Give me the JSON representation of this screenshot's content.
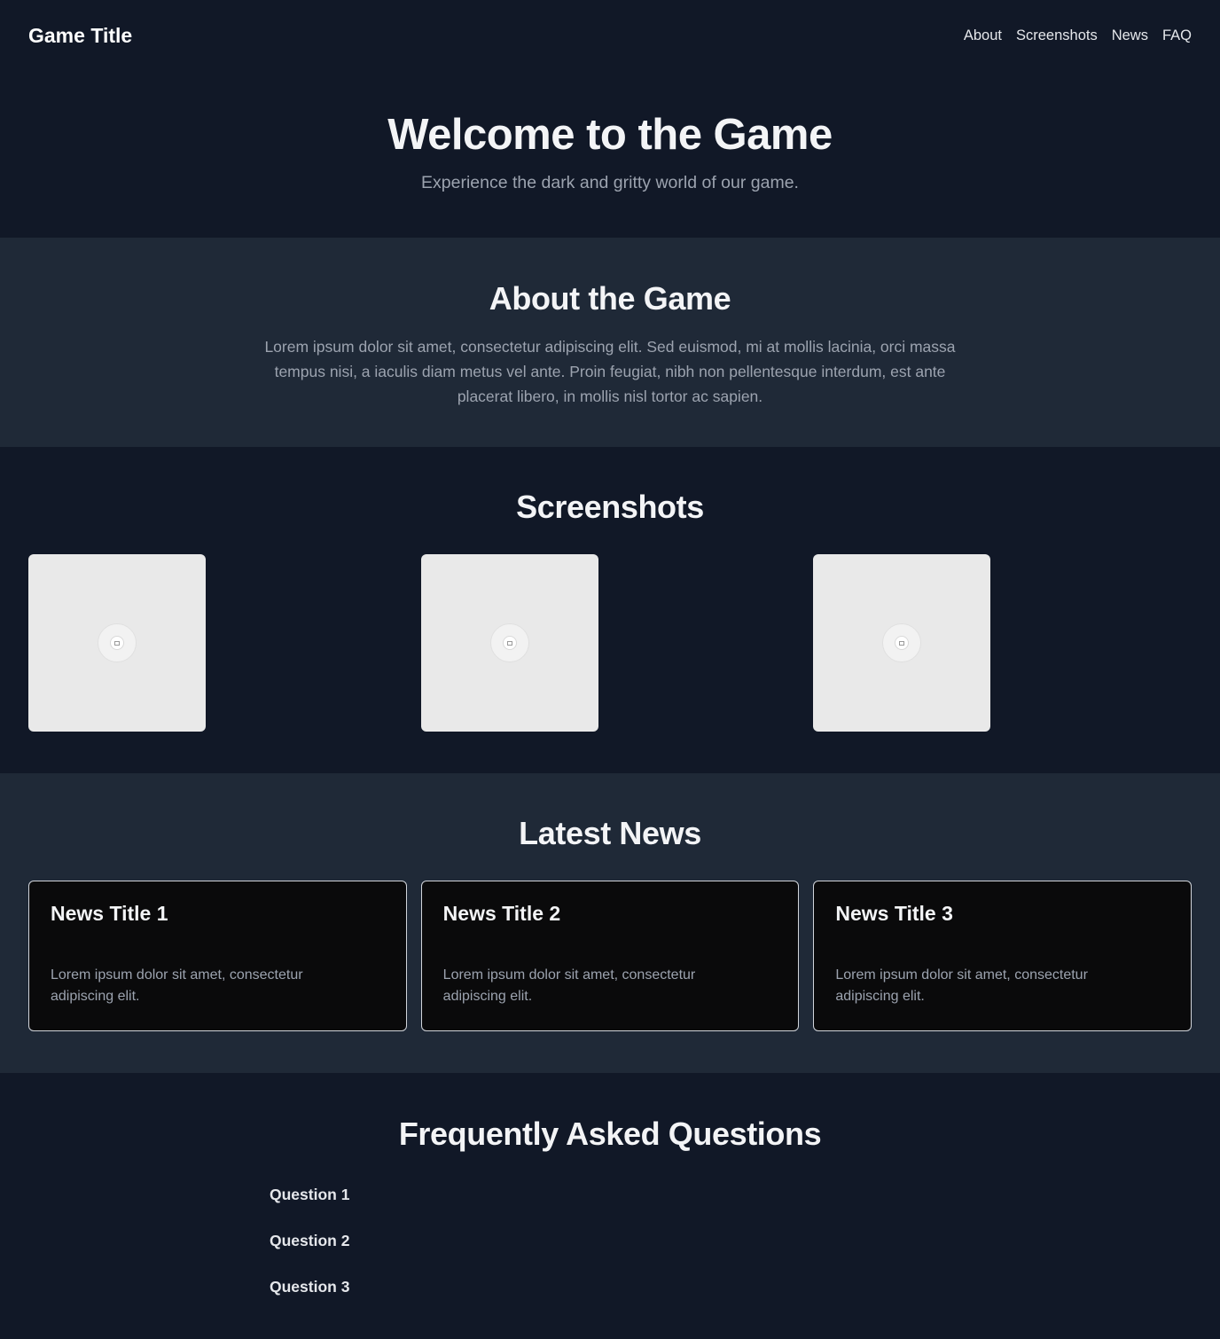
{
  "header": {
    "logo": "Game Title",
    "nav": [
      "About",
      "Screenshots",
      "News",
      "FAQ"
    ]
  },
  "hero": {
    "title": "Welcome to the Game",
    "subtitle": "Experience the dark and gritty world of our game."
  },
  "about": {
    "title": "About the Game",
    "body": "Lorem ipsum dolor sit amet, consectetur adipiscing elit. Sed euismod, mi at mollis lacinia, orci massa tempus nisi, a iaculis diam metus vel ante. Proin feugiat, nibh non pellentesque interdum, est ante placerat libero, in mollis nisl tortor ac sapien."
  },
  "screenshots": {
    "title": "Screenshots",
    "items": [
      {
        "icon": "image-placeholder-icon"
      },
      {
        "icon": "image-placeholder-icon"
      },
      {
        "icon": "image-placeholder-icon"
      }
    ]
  },
  "news": {
    "title": "Latest News",
    "items": [
      {
        "title": "News Title 1",
        "body": "Lorem ipsum dolor sit amet, consectetur adipiscing elit."
      },
      {
        "title": "News Title 2",
        "body": "Lorem ipsum dolor sit amet, consectetur adipiscing elit."
      },
      {
        "title": "News Title 3",
        "body": "Lorem ipsum dolor sit amet, consectetur adipiscing elit."
      }
    ]
  },
  "faq": {
    "title": "Frequently Asked Questions",
    "questions": [
      "Question 1",
      "Question 2",
      "Question 3"
    ]
  },
  "colors": {
    "background": "#111827",
    "section_alt": "#1f2937",
    "card_background": "#0a0a0b",
    "text_primary": "#f3f4f6",
    "text_muted": "#9ca3af"
  }
}
